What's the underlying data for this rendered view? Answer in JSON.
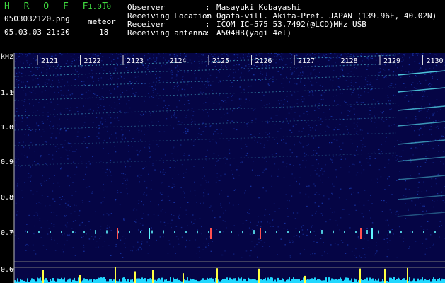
{
  "header": {
    "app_name": "H R O F F T",
    "version": "1.0.0",
    "filename": "0503032120.png",
    "mode": "meteor",
    "datetime": "05.03.03 21:20",
    "count": "18",
    "info": [
      {
        "label": "Observer",
        "value": "Masayuki Kobayashi"
      },
      {
        "label": "Receiving Location",
        "value": "Ogata-vill. Akita-Pref. JAPAN (139.96E, 40.02N)"
      },
      {
        "label": "Receiver",
        "value": "ICOM IC-575 53.7492(@LCD)MHz USB"
      },
      {
        "label": "Receiving antenna",
        "value": "A504HB(yagi 4el)"
      }
    ]
  },
  "spectrogram": {
    "unit_label": "kHz",
    "freq_ticks": [
      "1.1",
      "1.0",
      "0.9",
      "0.8",
      "0.7",
      "0.6"
    ],
    "time_labels": [
      "2121",
      "2122",
      "2123",
      "2124",
      "2125",
      "2126",
      "2127",
      "2128",
      "2129",
      "2130"
    ],
    "colors": {
      "background": "#050545",
      "noise": "#1a3ab0",
      "signal": "#5ff5ff",
      "meteor": "#ffff40",
      "ping": "#ff5050",
      "level": "#20d8ff"
    }
  }
}
